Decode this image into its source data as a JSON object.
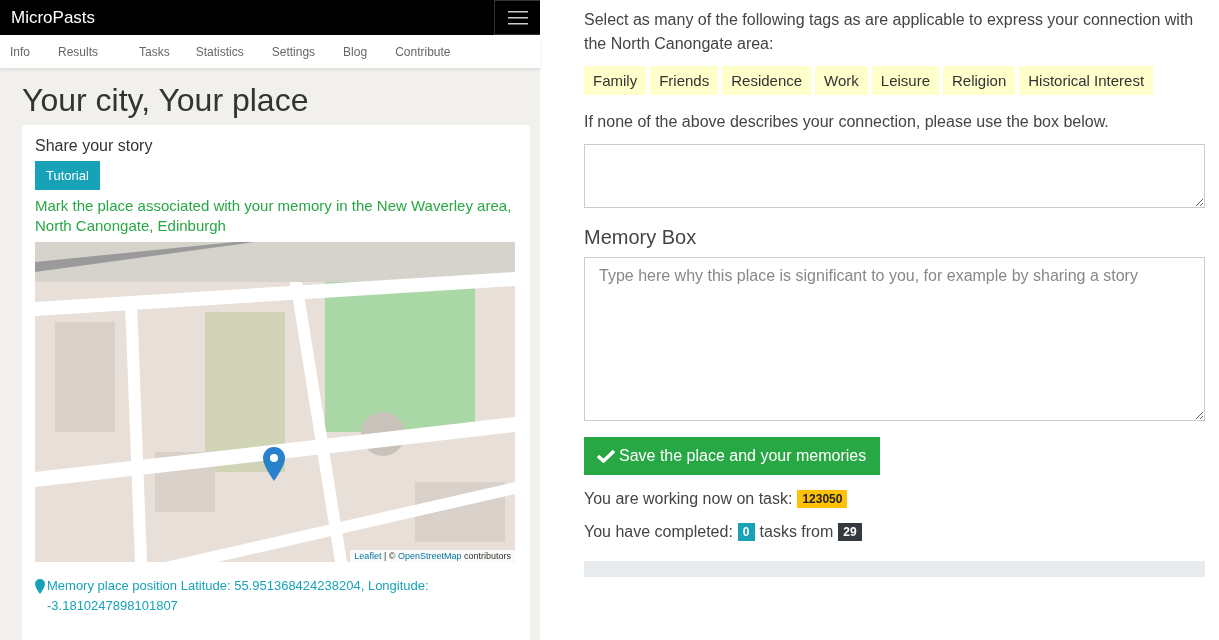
{
  "navbar": {
    "brand": "MicroPasts"
  },
  "nav_links": [
    "Info",
    "Results",
    "Tasks",
    "Statistics",
    "Settings",
    "Blog",
    "Contribute"
  ],
  "page_title": "Your city, Your place",
  "card": {
    "heading": "Share your story",
    "tutorial_button": "Tutorial",
    "instruction": "Mark the place associated with your memory in the New Waverley area, North Canongate, Edinburgh",
    "map": {
      "kind": "picture",
      "attribution": {
        "leaflet": "Leaflet",
        "separator": "| ©",
        "osm": "OpenStreetMap",
        "contributors": "contributors"
      }
    },
    "position": "Memory place position Latitude: 55.951368424238204, Longitude: -3.1810247898101807"
  },
  "tags_prompt": "Select as many of the following tags as are applicable to express your connection with the North Canongate area:",
  "tags": [
    "Family",
    "Friends",
    "Residence",
    "Work",
    "Leisure",
    "Religion",
    "Historical Interest"
  ],
  "other_prompt": "If none of the above describes your connection, please use the box below.",
  "memory_heading": "Memory Box",
  "memory_placeholder": "Type here why this place is significant to you, for example by sharing a story",
  "save_button": "Save the place and your memories",
  "task_line": {
    "text": "You are working now on task:",
    "task_id": "123050"
  },
  "completed_line": {
    "text": "You have completed:",
    "done": "0",
    "middle": "tasks from",
    "total": "29"
  },
  "progress": {
    "level": 0
  }
}
